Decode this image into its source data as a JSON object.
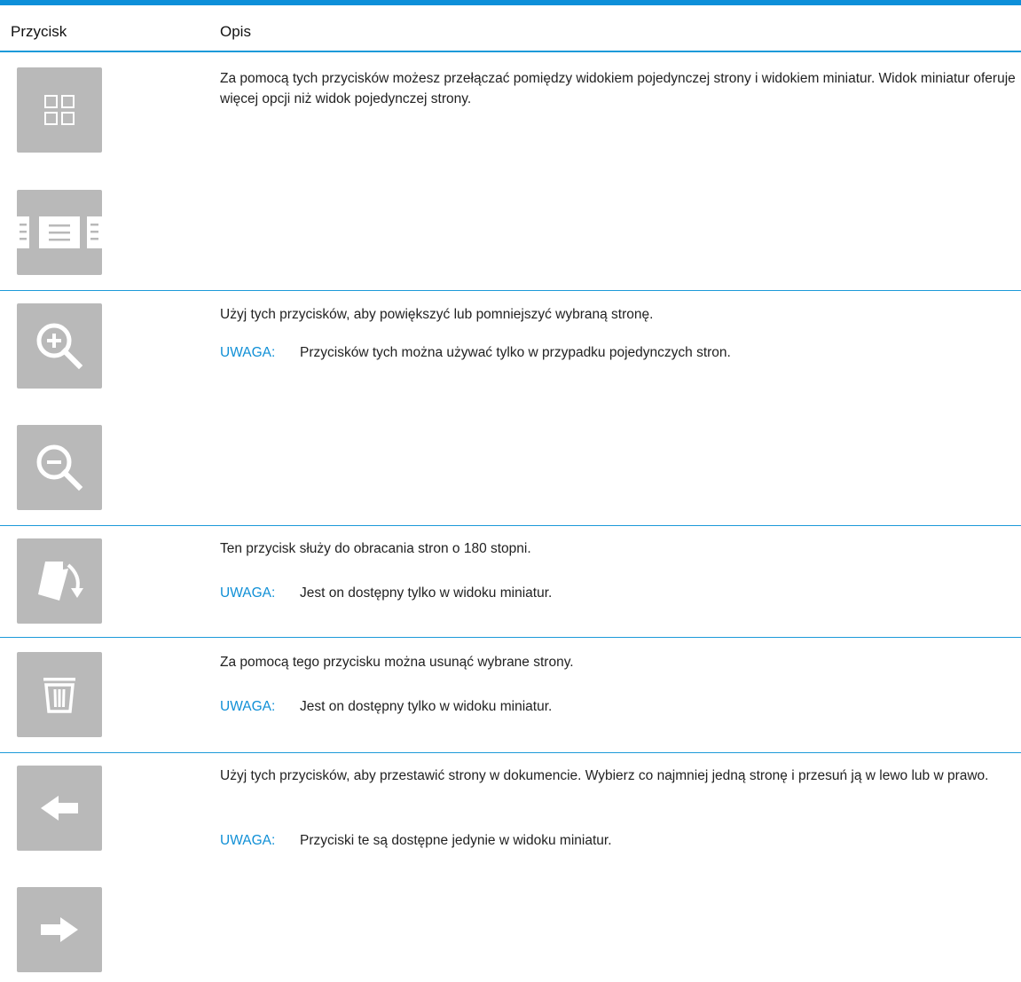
{
  "table": {
    "col_button": "Przycisk",
    "col_description": "Opis"
  },
  "accent_color": "#0d8fd9",
  "button_color": "#b9b9b9",
  "rows": [
    {
      "icons": [
        "thumbnail-view-icon",
        "single-page-view-icon"
      ],
      "description": "Za pomocą tych przycisków możesz przełączać pomiędzy widokiem pojedynczej strony i widokiem miniatur. Widok miniatur oferuje więcej opcji niż widok pojedynczej strony.",
      "note_label": "",
      "note_text": ""
    },
    {
      "icons": [
        "zoom-in-icon",
        "zoom-out-icon"
      ],
      "description": "Użyj tych przycisków, aby powiększyć lub pomniejszyć wybraną stronę.",
      "note_label": "UWAGA:",
      "note_text": "Przycisków tych można używać tylko w przypadku pojedynczych stron."
    },
    {
      "icons": [
        "rotate-page-icon"
      ],
      "description": "Ten przycisk służy do obracania stron o 180 stopni.",
      "note_label": "UWAGA:",
      "note_text": "Jest on dostępny tylko w widoku miniatur."
    },
    {
      "icons": [
        "delete-trash-icon"
      ],
      "description": "Za pomocą tego przycisku można usunąć wybrane strony.",
      "note_label": "UWAGA:",
      "note_text": "Jest on dostępny tylko w widoku miniatur."
    },
    {
      "icons": [
        "arrow-left-icon",
        "arrow-right-icon"
      ],
      "description": "Użyj tych przycisków, aby przestawić strony w dokumencie. Wybierz co najmniej jedną stronę i przesuń ją w lewo lub w prawo.",
      "note_label": "UWAGA:",
      "note_text": "Przyciski te są dostępne jedynie w widoku miniatur."
    }
  ]
}
